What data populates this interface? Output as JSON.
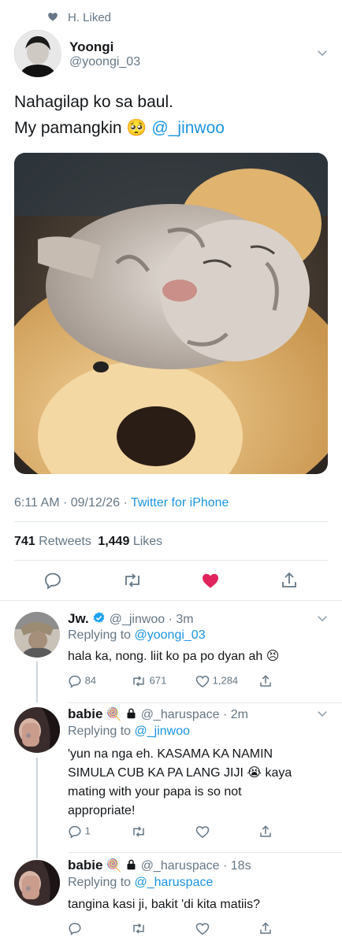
{
  "social_context": {
    "text": "H. Liked"
  },
  "main_tweet": {
    "author_name": "Yoongi",
    "author_handle": "@yoongi_03",
    "text_line1": "Nahagilap ko sa baul.",
    "text_line2_prefix": "My pamangkin",
    "emoji": "🥺",
    "mention": "@_jinwoo",
    "timestamp": "6:11 AM · 09/12/26",
    "source_sep": "·",
    "source": "Twitter for iPhone",
    "retweets_count": "741",
    "retweets_label": "Retweets",
    "likes_count": "1,449",
    "likes_label": "Likes",
    "liked": true,
    "like_color": "#e0245e"
  },
  "replies": [
    {
      "name": "Jw.",
      "verified": true,
      "handle_time": "@_jinwoo · 3m",
      "replying_label": "Replying to",
      "replying_to": "@yoongi_03",
      "text": "hala ka, nong. liit ko pa po dyan ah 😣",
      "reply_count": "84",
      "retweet_count": "671",
      "like_count": "1,284"
    },
    {
      "name": "babie",
      "emoji": "🍭",
      "locked": true,
      "handle_time": "@_haruspace · 2m",
      "replying_label": "Replying to",
      "replying_to": "@_jinwoo",
      "text_lines": [
        "'yun na nga eh. KASAMA KA NAMIN",
        "SIMULA CUB KA PA LANG JIJI 😭 kaya",
        "mating with your papa is so not",
        "appropriate!"
      ],
      "reply_count": "1",
      "retweet_count": "",
      "like_count": ""
    },
    {
      "name": "babie",
      "emoji": "🍭",
      "locked": true,
      "handle_time": "@_haruspace · 18s",
      "replying_label": "Replying to",
      "replying_to": "@_haruspace",
      "text": "tangina kasi ji, bakit 'di kita matiis?",
      "reply_count": "",
      "retweet_count": "",
      "like_count": ""
    }
  ]
}
